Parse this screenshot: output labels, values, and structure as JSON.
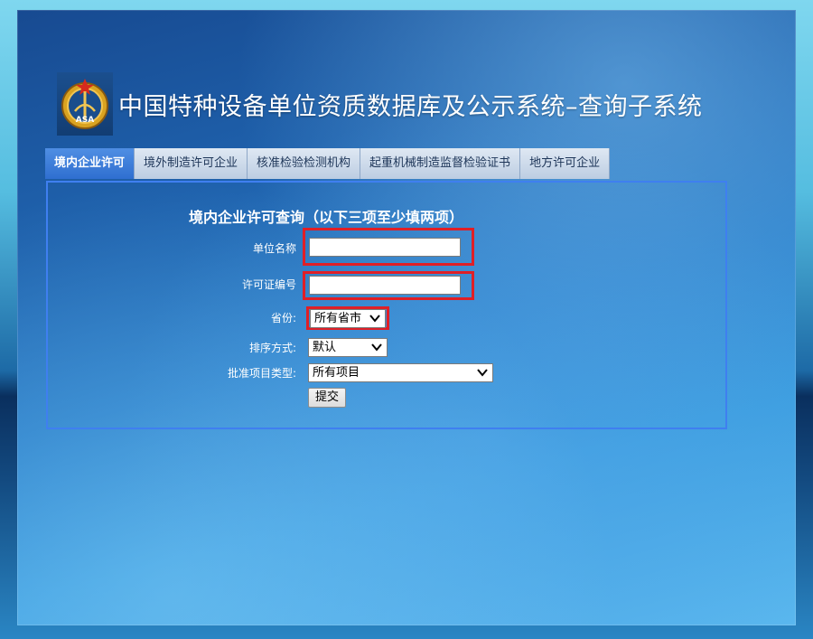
{
  "header": {
    "title": "中国特种设备单位资质数据库及公示系统–查询子系统",
    "emblem_icon": "customs-emblem-icon",
    "emblem_text": "ASA"
  },
  "tabs": [
    {
      "label": "境内企业许可",
      "active": true
    },
    {
      "label": "境外制造许可企业",
      "active": false
    },
    {
      "label": "核准检验检测机构",
      "active": false
    },
    {
      "label": "起重机械制造监督检验证书",
      "active": false
    },
    {
      "label": "地方许可企业",
      "active": false
    }
  ],
  "form": {
    "title": "境内企业许可查询（以下三项至少填两项）",
    "unit_name_label": "单位名称",
    "unit_name_value": "",
    "license_no_label": "许可证编号",
    "license_no_value": "",
    "province_label": "省份:",
    "province_value": "所有省市",
    "sort_label": "排序方式:",
    "sort_value": "默认",
    "project_type_label": "批准项目类型:",
    "project_type_value": "所有项目",
    "submit_label": "提交"
  },
  "colors": {
    "highlight": "#e01f26",
    "panel_border": "#3f7ff0",
    "active_tab": "#2f6fd0"
  }
}
